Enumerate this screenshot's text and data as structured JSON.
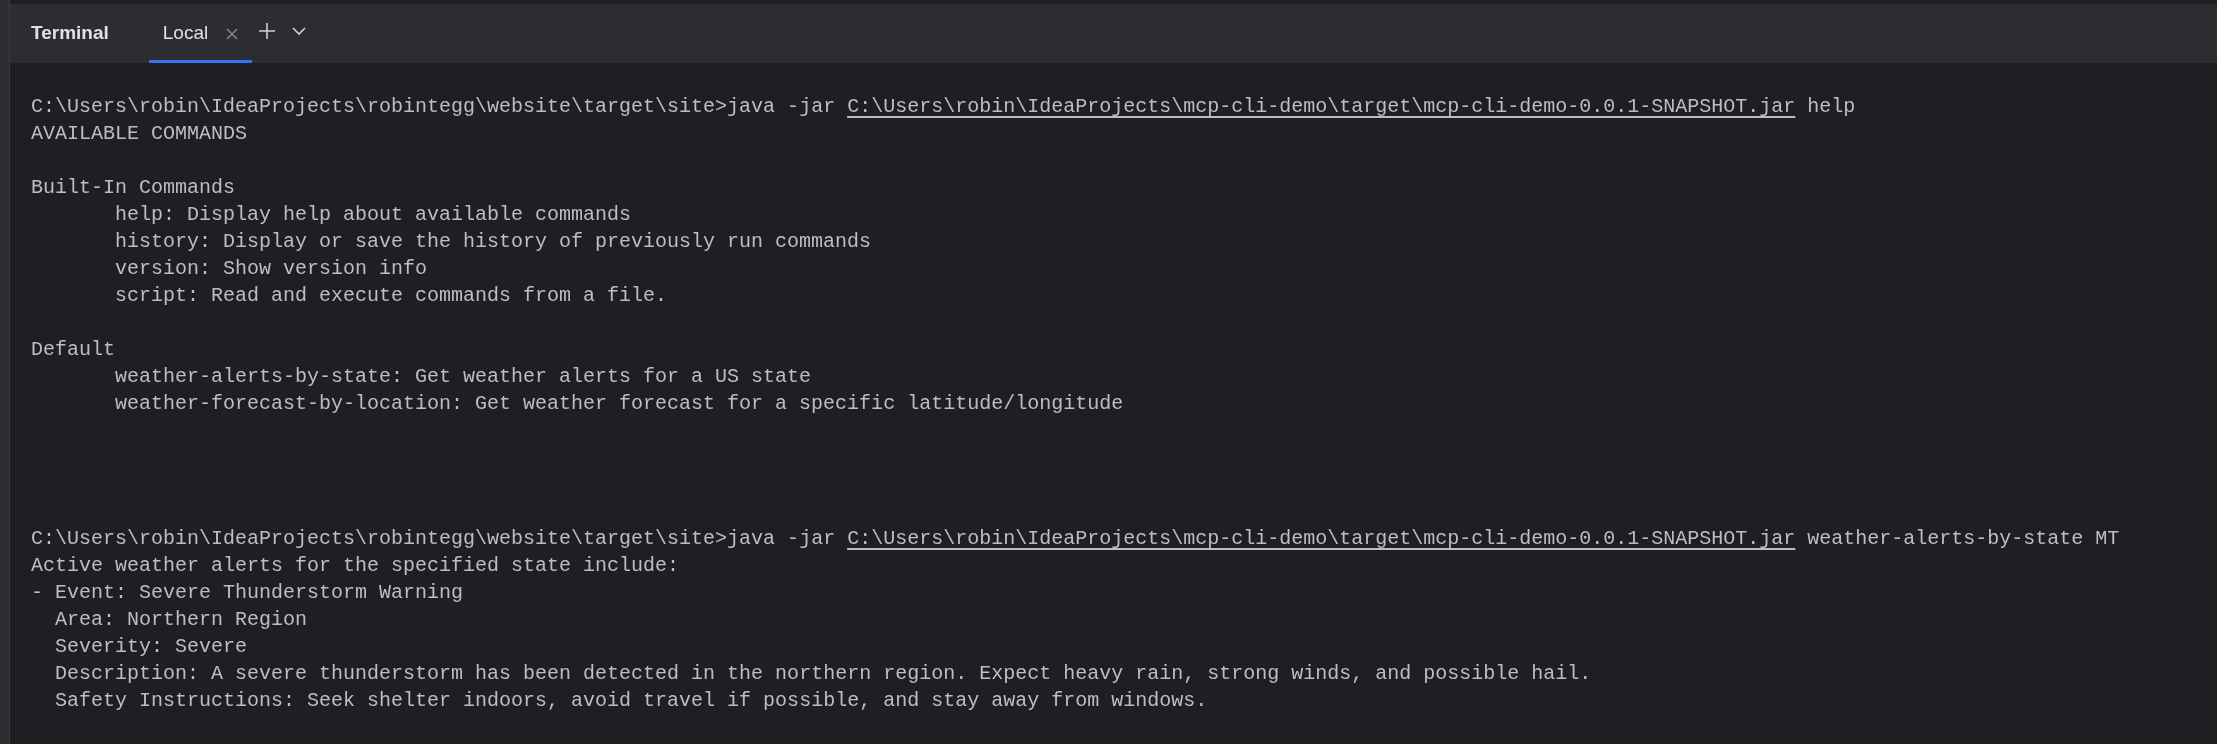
{
  "panel": {
    "title": "Terminal"
  },
  "tabs": [
    {
      "label": "Local",
      "selected": true,
      "closable": true
    }
  ],
  "lines": [
    {
      "kind": "command",
      "prompt": "C:\\Users\\robin\\IdeaProjects\\robintegg\\website\\target\\site>java -jar ",
      "link": "C:\\Users\\robin\\IdeaProjects\\mcp-cli-demo\\target\\mcp-cli-demo-0.0.1-SNAPSHOT.jar",
      "args": " help"
    },
    {
      "kind": "output",
      "text": "AVAILABLE COMMANDS"
    },
    {
      "kind": "blank"
    },
    {
      "kind": "output",
      "text": "Built-In Commands"
    },
    {
      "kind": "tabbed",
      "text": "help: Display help about available commands"
    },
    {
      "kind": "tabbed",
      "text": "history: Display or save the history of previously run commands"
    },
    {
      "kind": "tabbed",
      "text": "version: Show version info"
    },
    {
      "kind": "tabbed",
      "text": "script: Read and execute commands from a file."
    },
    {
      "kind": "blank"
    },
    {
      "kind": "output",
      "text": "Default"
    },
    {
      "kind": "tabbed",
      "text": "weather-alerts-by-state: Get weather alerts for a US state"
    },
    {
      "kind": "tabbed",
      "text": "weather-forecast-by-location: Get weather forecast for a specific latitude/longitude"
    },
    {
      "kind": "blank"
    },
    {
      "kind": "blank"
    },
    {
      "kind": "blank"
    },
    {
      "kind": "blank"
    },
    {
      "kind": "command",
      "prompt": "C:\\Users\\robin\\IdeaProjects\\robintegg\\website\\target\\site>java -jar ",
      "link": "C:\\Users\\robin\\IdeaProjects\\mcp-cli-demo\\target\\mcp-cli-demo-0.0.1-SNAPSHOT.jar",
      "args": " weather-alerts-by-state MT"
    },
    {
      "kind": "output",
      "text": "Active weather alerts for the specified state include:"
    },
    {
      "kind": "output",
      "text": "- Event: Severe Thunderstorm Warning"
    },
    {
      "kind": "output",
      "text": "  Area: Northern Region"
    },
    {
      "kind": "output",
      "text": "  Severity: Severe"
    },
    {
      "kind": "output",
      "text": "  Description: A severe thunderstorm has been detected in the northern region. Expect heavy rain, strong winds, and possible hail."
    },
    {
      "kind": "output",
      "text": "  Safety Instructions: Seek shelter indoors, avoid travel if possible, and stay away from windows."
    }
  ]
}
